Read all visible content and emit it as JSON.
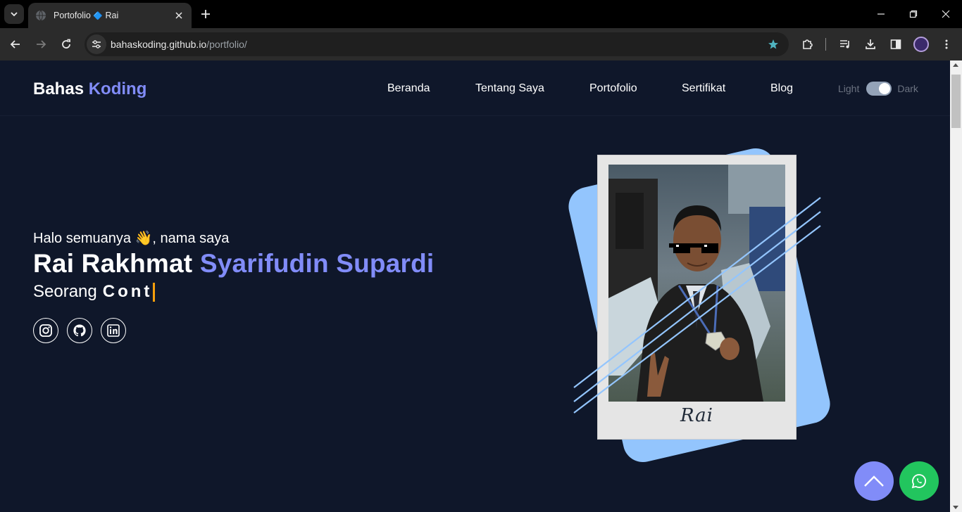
{
  "browser": {
    "tab": {
      "title": "Portofolio",
      "title_sep": "🔷",
      "title_suffix": "Rai"
    },
    "url": {
      "host": "bahaskoding.github.io",
      "path": "/portfolio/"
    }
  },
  "navbar": {
    "brand": {
      "first": "Bahas",
      "second": "Koding"
    },
    "links": [
      "Beranda",
      "Tentang Saya",
      "Portofolio",
      "Sertifikat",
      "Blog"
    ],
    "theme": {
      "light_label": "Light",
      "dark_label": "Dark",
      "mode": "dark"
    }
  },
  "hero": {
    "greeting": "Halo semuanya 👋, nama saya",
    "name_first": "Rai Rakhmat",
    "name_accent": "Syarifudin Supardi",
    "role_prefix": "Seorang",
    "role_typed": "Cont",
    "socials": [
      {
        "icon": "instagram-icon"
      },
      {
        "icon": "github-icon"
      },
      {
        "icon": "linkedin-icon"
      }
    ],
    "photo_caption": "Rai"
  },
  "colors": {
    "background": "#0f172a",
    "accent": "#818cf8",
    "photo_back": "#93c5fd",
    "cursor": "#f59e0b",
    "whatsapp": "#22c55e"
  }
}
